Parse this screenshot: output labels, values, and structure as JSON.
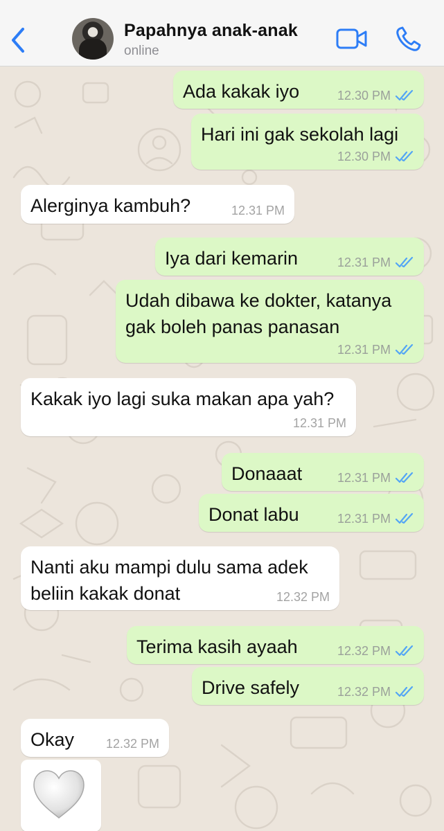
{
  "header": {
    "contact_name": "Papahnya anak-anak",
    "status": "online",
    "icons": [
      "chevron-left-icon",
      "video-call-icon",
      "phone-icon"
    ]
  },
  "colors": {
    "accent": "#2d7df6",
    "outgoing_bubble": "#dcf8c6",
    "incoming_bubble": "#ffffff",
    "read_ticks": "#53a5f5",
    "wallpaper": "#ece5dc"
  },
  "messages": [
    {
      "direction": "out",
      "text": "Ada kakak iyo",
      "time": "12.30 PM",
      "status": "read"
    },
    {
      "direction": "out",
      "text": "Hari ini gak sekolah lagi",
      "time": "12.30 PM",
      "status": "read"
    },
    {
      "direction": "in",
      "text": "Alerginya kambuh?",
      "time": "12.31 PM"
    },
    {
      "direction": "out",
      "text": "Iya dari kemarin",
      "time": "12.31 PM",
      "status": "read"
    },
    {
      "direction": "out",
      "text": "Udah dibawa ke dokter, katanya\ngak boleh panas panasan",
      "time": "12.31 PM",
      "status": "read"
    },
    {
      "direction": "in",
      "text": "Kakak iyo lagi suka makan apa yah?",
      "time": "12.31 PM"
    },
    {
      "direction": "out",
      "text": "Donaaat",
      "time": "12.31 PM",
      "status": "read"
    },
    {
      "direction": "out",
      "text": "Donat labu",
      "time": "12.31 PM",
      "status": "read"
    },
    {
      "direction": "in",
      "text": "Nanti aku mampi dulu sama adek\nbeliin kakak donat",
      "time": "12.32 PM"
    },
    {
      "direction": "out",
      "text": "Terima kasih ayaah",
      "time": "12.32 PM",
      "status": "read"
    },
    {
      "direction": "out",
      "text": "Drive safely",
      "time": "12.32 PM",
      "status": "read"
    },
    {
      "direction": "in",
      "text": "Okay",
      "time": "12.32 PM"
    },
    {
      "direction": "in",
      "emoji": "white-heart-icon"
    }
  ]
}
